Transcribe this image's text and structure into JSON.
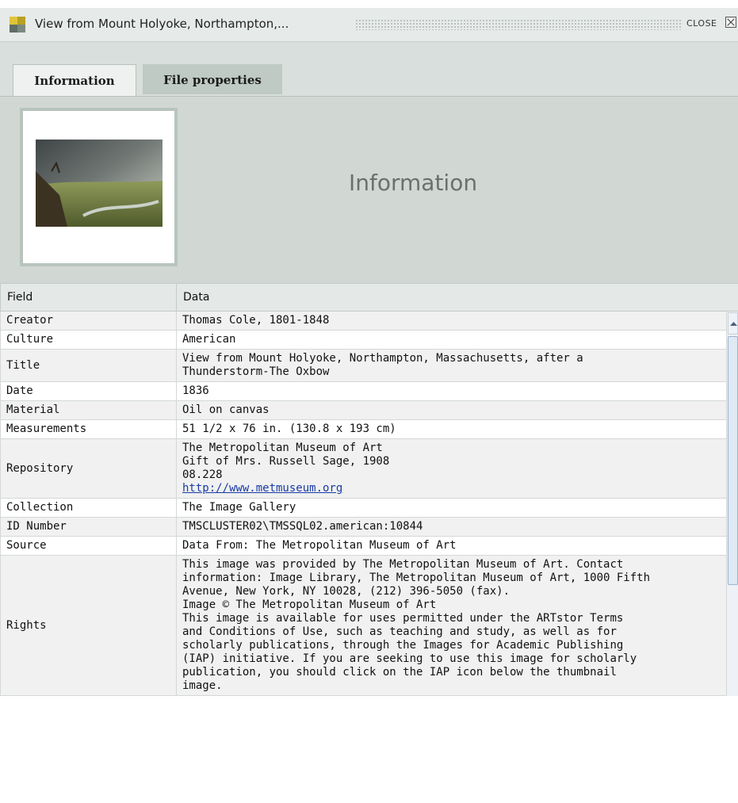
{
  "window": {
    "title": "View from Mount Holyoke, Northampton,...",
    "close_label": "CLOSE"
  },
  "tabs": [
    {
      "label": "Information",
      "active": true
    },
    {
      "label": "File properties",
      "active": false
    }
  ],
  "panel": {
    "heading": "Information"
  },
  "table": {
    "headers": [
      "Field",
      "Data"
    ],
    "rows": [
      {
        "field": "Creator",
        "lines": [
          "Thomas Cole, 1801-1848"
        ]
      },
      {
        "field": "Culture",
        "lines": [
          "American"
        ]
      },
      {
        "field": "Title",
        "lines": [
          "View from Mount Holyoke, Northampton, Massachusetts, after a",
          "Thunderstorm-The Oxbow"
        ]
      },
      {
        "field": "Date",
        "lines": [
          "1836"
        ]
      },
      {
        "field": "Material",
        "lines": [
          "Oil on canvas"
        ]
      },
      {
        "field": "Measurements",
        "lines": [
          "51 1/2 x 76 in. (130.8 x 193 cm)"
        ]
      },
      {
        "field": "Repository",
        "lines": [
          "The Metropolitan Museum of Art",
          "Gift of Mrs. Russell Sage, 1908",
          "08.228"
        ],
        "link": "http://www.metmuseum.org"
      },
      {
        "field": "Collection",
        "lines": [
          "The Image Gallery"
        ]
      },
      {
        "field": "ID Number",
        "lines": [
          "TMSCLUSTER02\\TMSSQL02.american:10844"
        ]
      },
      {
        "field": "Source",
        "lines": [
          "Data From: The Metropolitan Museum of Art"
        ]
      },
      {
        "field": "Rights",
        "lines": [
          "This image was provided by The Metropolitan Museum of Art. Contact",
          "information: Image Library, The Metropolitan Museum of Art, 1000 Fifth",
          "Avenue, New York, NY 10028, (212) 396-5050 (fax).",
          "Image © The Metropolitan Museum of Art",
          "This image is available for uses permitted under the ARTstor Terms",
          "and Conditions of Use, such as teaching and study, as well as for",
          "scholarly publications, through the Images for Academic Publishing",
          "(IAP) initiative. If you are seeking to use this image for scholarly",
          "publication, you should click on the IAP icon below the thumbnail",
          "image."
        ]
      }
    ]
  },
  "icons": {
    "app": "window-app-icon",
    "close": "close-x-icon",
    "thumbnail": "painting-thumbnail"
  }
}
